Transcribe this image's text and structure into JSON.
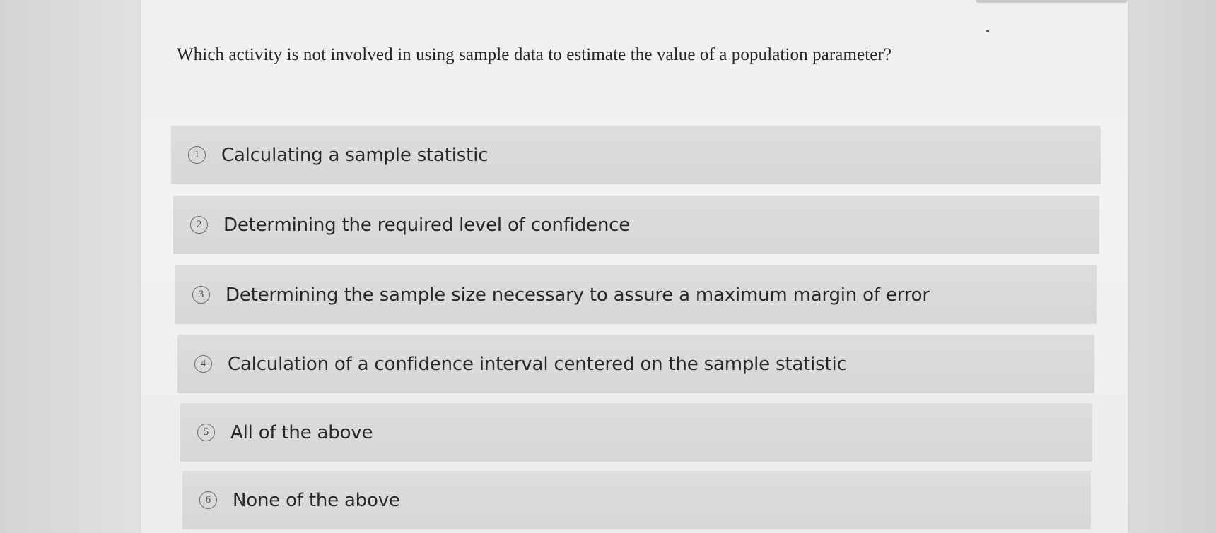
{
  "question": {
    "text": "Which activity is not involved in using sample data to estimate the value of a population parameter?"
  },
  "options": [
    {
      "number": "1",
      "label": "Calculating a sample statistic"
    },
    {
      "number": "2",
      "label": "Determining the required level of confidence"
    },
    {
      "number": "3",
      "label": "Determining the sample size necessary to assure a maximum margin of error"
    },
    {
      "number": "4",
      "label": "Calculation of a confidence interval centered on the sample statistic"
    },
    {
      "number": "5",
      "label": "All of the above"
    },
    {
      "number": "6",
      "label": "None of the above"
    }
  ],
  "colors": {
    "page_background": "#e4e5e5",
    "card_background": "#f2f2f2",
    "option_background": "#dadbdb",
    "text": "#262626"
  }
}
